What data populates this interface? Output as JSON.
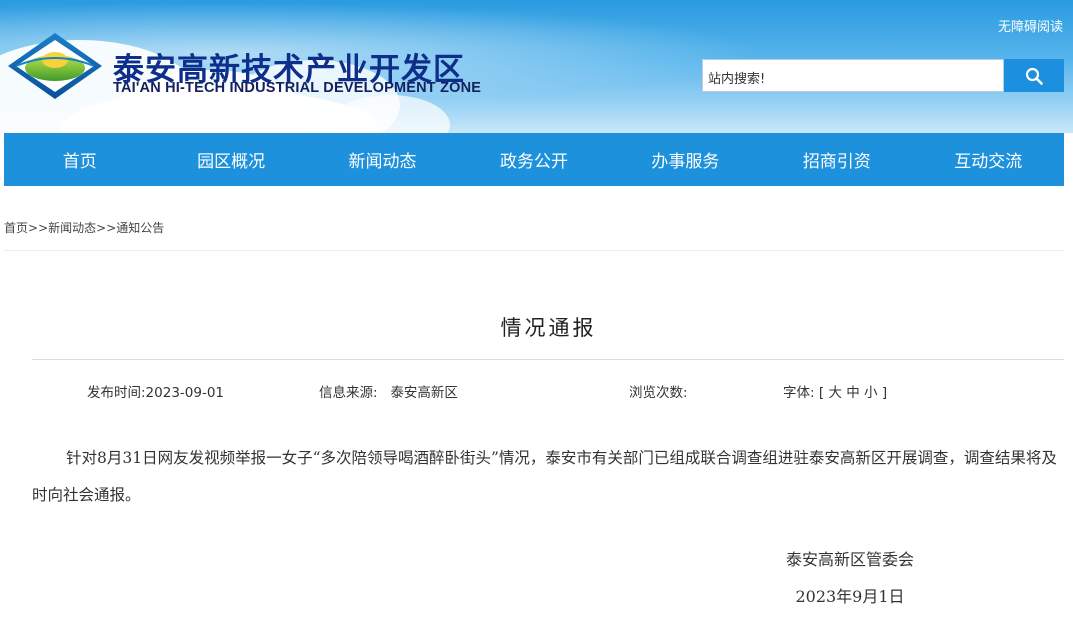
{
  "header": {
    "title_cn": "泰安高新技术产业开发区",
    "title_en": "TAI'AN HI-TECH INDUSTRIAL DEVELOPMENT ZONE",
    "accessibility_label": "无障碍阅读",
    "search_placeholder": "站内搜索!",
    "search_icon": "search-icon",
    "brand_color": "#1d91dc"
  },
  "nav": {
    "items": [
      "首页",
      "园区概况",
      "新闻动态",
      "政务公开",
      "办事服务",
      "招商引资",
      "互动交流"
    ]
  },
  "breadcrumb": {
    "items": [
      "首页",
      "新闻动态",
      "通知公告"
    ],
    "separator": ">>"
  },
  "article": {
    "title": "情况通报",
    "publish_time": "发布时间:2023-09-01",
    "source_label": "信息来源:",
    "source_value": "泰安高新区",
    "views_label": "浏览次数:",
    "font_label": "字体:",
    "font_bracket_open": "[",
    "font_sizes": [
      "大",
      "中",
      "小"
    ],
    "font_bracket_close": "]",
    "body": "针对8月31日网友发视频举报一女子“多次陪领导喝酒醉卧街头”情况，泰安市有关部门已组成联合调查组进驻泰安高新区开展调查，调查结果将及时向社会通报。",
    "signature": "泰安高新区管委会",
    "date": "2023年9月1日"
  }
}
